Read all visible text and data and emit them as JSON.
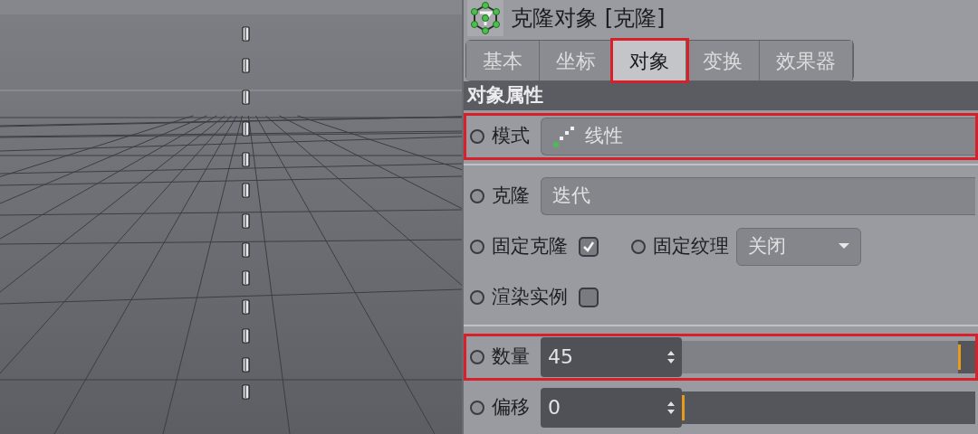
{
  "object_title": "克隆对象 [克隆]",
  "tabs": [
    {
      "label": "基本",
      "selected": false,
      "highlighted": false
    },
    {
      "label": "坐标",
      "selected": false,
      "highlighted": false
    },
    {
      "label": "对象",
      "selected": true,
      "highlighted": true
    },
    {
      "label": "变换",
      "selected": false,
      "highlighted": false
    },
    {
      "label": "效果器",
      "selected": false,
      "highlighted": false
    }
  ],
  "section_title": "对象属性",
  "groups": [
    [
      {
        "highlighted": true,
        "items": [
          {
            "kind": "mode_select",
            "label": "模式",
            "value": "线性"
          }
        ]
      }
    ],
    [
      {
        "highlighted": false,
        "items": [
          {
            "kind": "select",
            "label": "克隆",
            "value": "迭代"
          }
        ]
      },
      {
        "highlighted": false,
        "items": [
          {
            "kind": "checkbox",
            "label": "固定克隆",
            "checked": true
          },
          {
            "kind": "dropdown",
            "label": "固定纹理",
            "value": "关闭"
          }
        ]
      },
      {
        "highlighted": false,
        "items": [
          {
            "kind": "checkbox",
            "label": "渲染实例",
            "checked": false
          }
        ]
      }
    ],
    [
      {
        "highlighted": true,
        "items": [
          {
            "kind": "number_slider",
            "label": "数量",
            "value": "45",
            "level": 0.94
          }
        ]
      },
      {
        "highlighted": false,
        "items": [
          {
            "kind": "number_slider",
            "label": "偏移",
            "value": "0",
            "level": 0
          }
        ]
      }
    ]
  ]
}
